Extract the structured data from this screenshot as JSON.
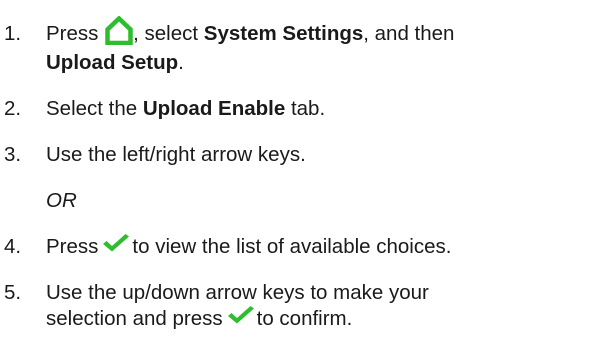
{
  "steps": [
    {
      "number": "1.",
      "part1": "Press",
      "part2": ", select",
      "bold1": "System Settings",
      "part3": ", and then",
      "bold2": "Upload Setup",
      "part4": "."
    },
    {
      "number": "2.",
      "part1": "Select the",
      "bold1": "Upload Enable",
      "part2": " tab."
    },
    {
      "number": "3.",
      "text": "Use the left/right arrow keys."
    },
    {
      "or_text": "OR"
    },
    {
      "number": "4.",
      "part1": "Press",
      "part2": "to view the list of available choices."
    },
    {
      "number": "5.",
      "line1": "Use the up/down arrow keys to make your",
      "part1": "selection and press",
      "part2": "to confirm."
    }
  ],
  "icons": {
    "home": "home-icon",
    "check": "check-icon",
    "color": "#2ebd2e"
  }
}
